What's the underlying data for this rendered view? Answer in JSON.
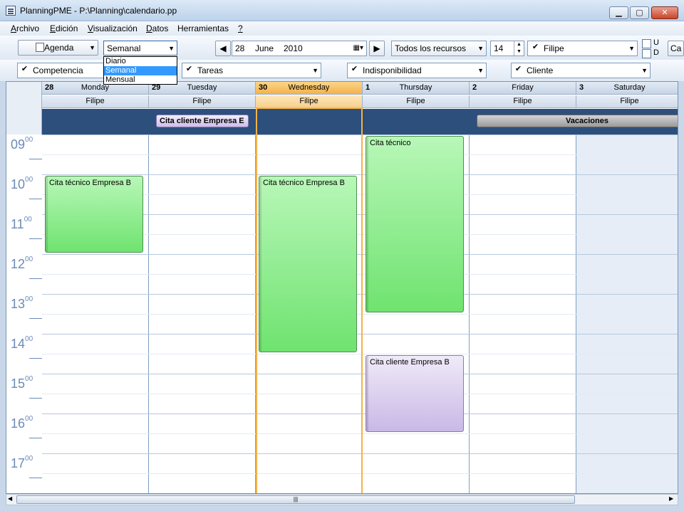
{
  "window": {
    "title": "PlanningPME - P:\\Planning\\calendario.pp"
  },
  "menu": [
    {
      "label": "Archivo",
      "accel": "A",
      "rest": "rchivo"
    },
    {
      "label": "Edición",
      "accel": "E",
      "rest": "dición"
    },
    {
      "label": "Visualización",
      "accel": "V",
      "rest": "isualización"
    },
    {
      "label": "Datos",
      "accel": "D",
      "rest": "atos"
    },
    {
      "label": "Herramientas",
      "accel": "",
      "rest": "Herramientas"
    },
    {
      "label": "?",
      "accel": "?",
      "rest": ""
    }
  ],
  "toolbar": {
    "view_button": "Agenda",
    "view_mode": "Semanal",
    "view_options": [
      "Diario",
      "Semanal",
      "Mensual"
    ],
    "date_day": "28",
    "date_month": "June",
    "date_year": "2010",
    "resources": "Todos los recursos",
    "count": "14",
    "person": "Filipe",
    "u_label": "U",
    "d_label": "D",
    "cut_button": "Ca"
  },
  "filters": [
    {
      "label": "Competencia",
      "checked": true
    },
    {
      "label": "Tareas",
      "checked": true
    },
    {
      "label": "Indisponibilidad",
      "checked": true
    },
    {
      "label": "Cliente",
      "checked": true
    }
  ],
  "days": [
    {
      "num": "28",
      "name": "Monday",
      "resource": "Filipe"
    },
    {
      "num": "29",
      "name": "Tuesday",
      "resource": "Filipe"
    },
    {
      "num": "30",
      "name": "Wednesday",
      "resource": "Filipe",
      "today": true
    },
    {
      "num": "1",
      "name": "Thursday",
      "resource": "Filipe"
    },
    {
      "num": "2",
      "name": "Friday",
      "resource": "Filipe"
    },
    {
      "num": "3",
      "name": "Saturday",
      "resource": "Filipe"
    }
  ],
  "allday_events": [
    {
      "label": "Cita cliente Empresa E",
      "day": 1
    },
    {
      "label": "Vacaciones",
      "day": 4
    }
  ],
  "hours": [
    "09",
    "10",
    "11",
    "12",
    "13",
    "14",
    "15",
    "16",
    "17"
  ],
  "minutes": "00",
  "events": [
    {
      "label": "Cita técnico Empresa B",
      "day": 0,
      "start": 10,
      "end": 12,
      "color": "green"
    },
    {
      "label": "Cita técnico Empresa B",
      "day": 2,
      "start": 10,
      "end": 14.5,
      "color": "green"
    },
    {
      "label": "Cita técnico",
      "day": 3,
      "start": 9,
      "end": 13.5,
      "color": "green"
    },
    {
      "label": "Cita cliente Empresa B",
      "day": 3,
      "start": 14.5,
      "end": 16.5,
      "color": "purple"
    }
  ],
  "colors": {
    "today": "#f4b24a",
    "allday_bg": "#2d4f7c",
    "green": "#6fe36f",
    "purple": "#c9b8e6"
  }
}
